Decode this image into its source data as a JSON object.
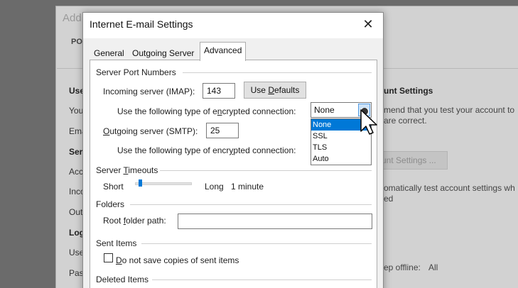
{
  "background": {
    "title": "Add",
    "section_label": "PO",
    "left_items": [
      "Use",
      "You",
      "Ema",
      "Ser",
      "Acc",
      "Inco",
      "Out",
      "Log",
      "Use",
      "Pas"
    ],
    "right_heading": "unt Settings",
    "right_lines": [
      "mend that you test your account to",
      "are correct."
    ],
    "button_label": "unt Settings ...",
    "right_lines_2": [
      "omatically test account settings wh",
      "ed"
    ],
    "offline_label": "ep offline:",
    "offline_value": "All"
  },
  "dialog": {
    "title": "Internet E-mail Settings",
    "close_glyph": "✕",
    "tabs": [
      {
        "label": "General"
      },
      {
        "label": "Outgoing Server"
      },
      {
        "label": "Advanced"
      }
    ],
    "server_ports": {
      "heading": "Server Port Numbers",
      "incoming_label": "Incoming server (IMAP):",
      "incoming_value": "143",
      "use_defaults_pre": "Use ",
      "use_defaults_u": "D",
      "use_defaults_post": "efaults",
      "encryption_label_pre": "Use the following type of e",
      "encryption_label_u": "n",
      "encryption_label_post": "crypted connection:",
      "incoming_encryption": "None",
      "outgoing_label_u": "O",
      "outgoing_label_post": "utgoing server (SMTP):",
      "outgoing_value": "25",
      "outgoing_encryption_label_pre": "Use the following type of encr",
      "outgoing_encryption_label_u": "y",
      "outgoing_encryption_label_post": "pted connection:",
      "dropdown_options": [
        "None",
        "SSL",
        "TLS",
        "Auto"
      ],
      "dropdown_selected": "None"
    },
    "timeouts": {
      "heading_pre": "Server ",
      "heading_u": "T",
      "heading_post": "imeouts",
      "short_label": "Short",
      "long_label": "Long",
      "value": "1 minute"
    },
    "folders": {
      "heading": "Folders",
      "root_label_pre": "Root ",
      "root_label_u": "f",
      "root_label_post": "older path:",
      "root_value": ""
    },
    "sent_items": {
      "heading": "Sent Items",
      "checkbox_u": "D",
      "checkbox_post": "o not save copies of sent items",
      "checked": false
    },
    "deleted_items": {
      "heading": "Deleted Items"
    }
  },
  "colors": {
    "accent": "#0078d7",
    "dropdown_button": "#cde3f7"
  }
}
